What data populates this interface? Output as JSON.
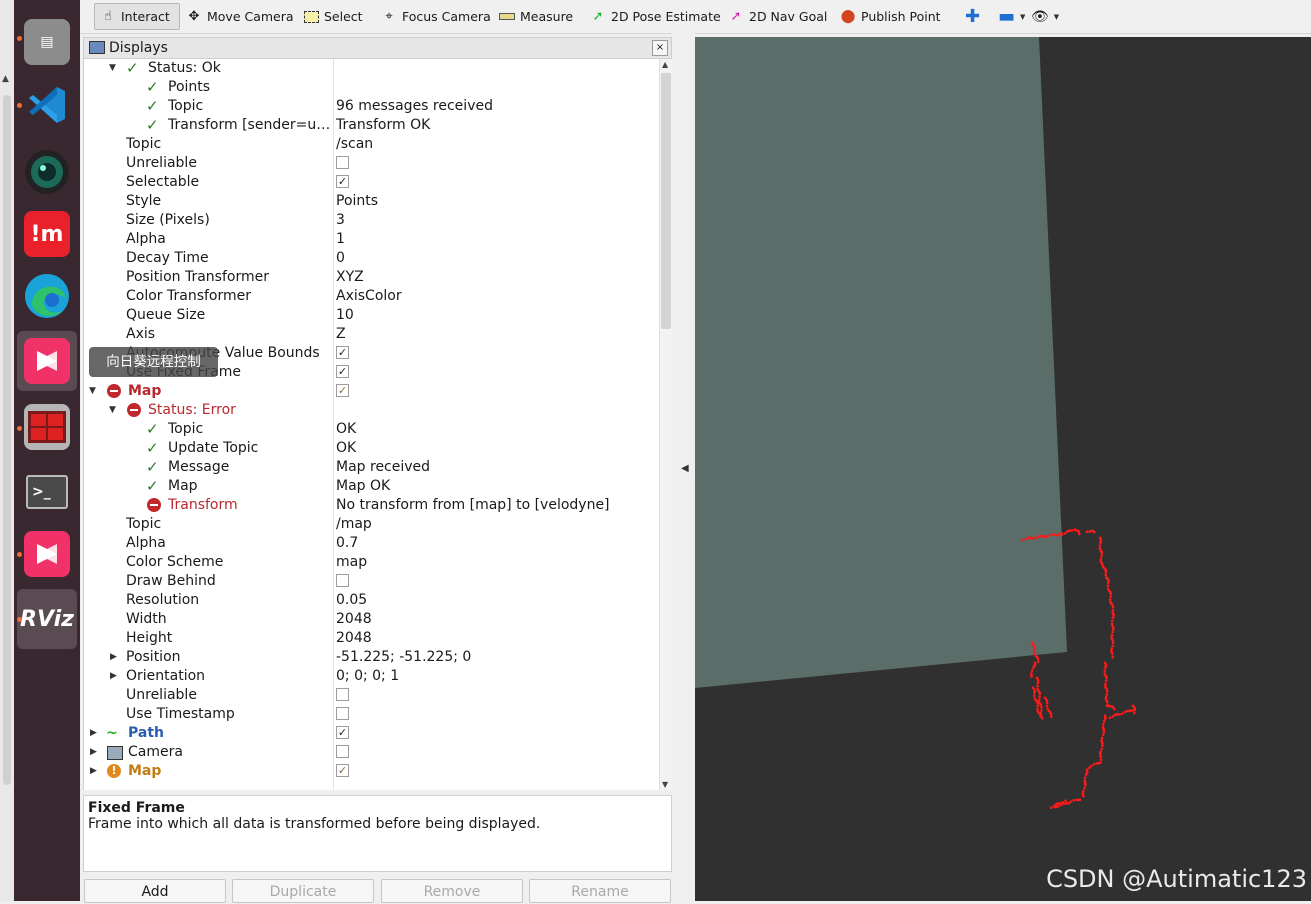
{
  "toolbar": {
    "interact": "Interact",
    "move_camera": "Move Camera",
    "select": "Select",
    "focus_camera": "Focus Camera",
    "measure": "Measure",
    "pose_estimate": "2D Pose Estimate",
    "nav_goal": "2D Nav Goal",
    "publish_point": "Publish Point"
  },
  "panel": {
    "title": "Displays",
    "close": "×"
  },
  "tooltip": "向日葵远程控制",
  "rows": {
    "status_ok": "Status: Ok",
    "points": "Points",
    "topic1": "Topic",
    "topic1_val": "96 messages received",
    "transform1": "Transform [sender=u…",
    "transform1_val": "Transform OK",
    "topic": "Topic",
    "topic_val": "/scan",
    "unreliable": "Unreliable",
    "selectable": "Selectable",
    "style": "Style",
    "style_val": "Points",
    "size": "Size (Pixels)",
    "size_val": "3",
    "alpha": "Alpha",
    "alpha_val": "1",
    "decay": "Decay Time",
    "decay_val": "0",
    "pos_tf": "Position Transformer",
    "pos_tf_val": "XYZ",
    "color_tf": "Color Transformer",
    "color_tf_val": "AxisColor",
    "queue": "Queue Size",
    "queue_val": "10",
    "axis": "Axis",
    "axis_val": "Z",
    "autocompute": "Autocompute Value Bounds",
    "fixed_frame": "Use Fixed Frame",
    "map": "Map",
    "status_error": "Status: Error",
    "m_topic": "Topic",
    "m_topic_val": "OK",
    "m_update": "Update Topic",
    "m_update_val": "OK",
    "m_message": "Message",
    "m_message_val": "Map received",
    "m_map": "Map",
    "m_map_val": "Map OK",
    "m_transform": "Transform",
    "m_transform_val": "No transform from [map] to [velodyne]",
    "topic2": "Topic",
    "topic2_val": "/map",
    "alpha2": "Alpha",
    "alpha2_val": "0.7",
    "scheme": "Color Scheme",
    "scheme_val": "map",
    "draw_behind": "Draw Behind",
    "resolution": "Resolution",
    "resolution_val": "0.05",
    "width": "Width",
    "width_val": "2048",
    "height": "Height",
    "height_val": "2048",
    "position": "Position",
    "position_val": "-51.225; -51.225; 0",
    "orientation": "Orientation",
    "orientation_val": "0; 0; 0; 1",
    "unreliable2": "Unreliable",
    "timestamp": "Use Timestamp",
    "path": "Path",
    "camera": "Camera",
    "map2": "Map"
  },
  "description": {
    "title": "Fixed Frame",
    "text": "Frame into which all data is transformed before being displayed."
  },
  "buttons": {
    "add": "Add",
    "duplicate": "Duplicate",
    "remove": "Remove",
    "rename": "Rename"
  },
  "watermark": "CSDN @Autimatic123",
  "colors": {
    "map_plane": "#5b6d69",
    "scan_points": "#ff1a1a",
    "background": "#303030"
  }
}
